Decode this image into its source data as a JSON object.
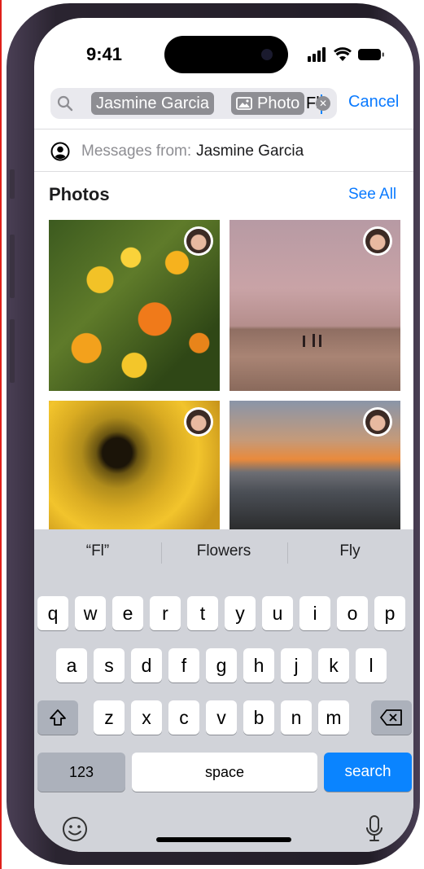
{
  "status_bar": {
    "time": "9:41"
  },
  "search": {
    "token_person": "Jasmine Garcia",
    "token_photo": "Photo",
    "typed_text": "Fl",
    "cancel_label": "Cancel"
  },
  "suggestion": {
    "prefix": "Messages from:",
    "name": "Jasmine Garcia"
  },
  "photos_section": {
    "title": "Photos",
    "see_all_label": "See All",
    "items": [
      {
        "subject": "orange and yellow flowers"
      },
      {
        "subject": "people on hilltop at sunset"
      },
      {
        "subject": "yellow flower close-up"
      },
      {
        "subject": "sunset over ocean coastline"
      }
    ]
  },
  "keyboard": {
    "predictions": [
      "“Fl”",
      "Flowers",
      "Fly"
    ],
    "row1": [
      "q",
      "w",
      "e",
      "r",
      "t",
      "y",
      "u",
      "i",
      "o",
      "p"
    ],
    "row2": [
      "a",
      "s",
      "d",
      "f",
      "g",
      "h",
      "j",
      "k",
      "l"
    ],
    "row3": [
      "z",
      "x",
      "c",
      "v",
      "b",
      "n",
      "m"
    ],
    "numbers_label": "123",
    "space_label": "space",
    "search_label": "search"
  },
  "colors": {
    "accent": "#0a7aff",
    "search_key": "#0a84ff",
    "keyboard_bg": "#d1d3d9"
  }
}
